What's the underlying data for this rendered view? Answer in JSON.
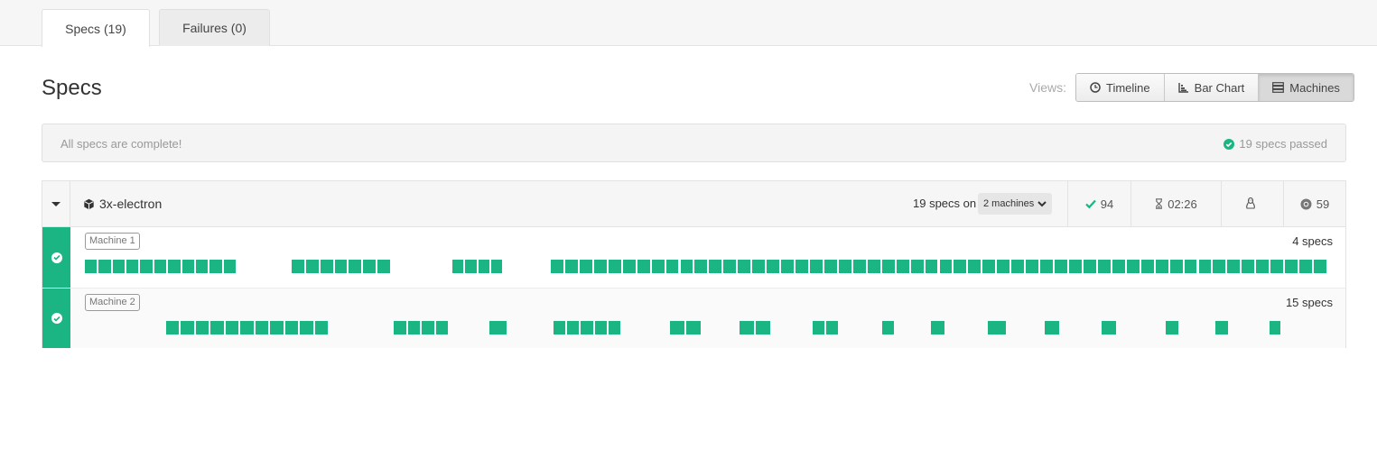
{
  "tabs": [
    {
      "label": "Specs (19)",
      "active": true
    },
    {
      "label": "Failures (0)",
      "active": false
    }
  ],
  "page": {
    "title": "Specs"
  },
  "views": {
    "label": "Views:",
    "buttons": [
      {
        "label": "Timeline",
        "icon": "clock-icon",
        "active": false
      },
      {
        "label": "Bar Chart",
        "icon": "bar-chart-icon",
        "active": false
      },
      {
        "label": "Machines",
        "icon": "server-icon",
        "active": true
      }
    ]
  },
  "status": {
    "message": "All specs are complete!",
    "passed": "19 specs passed"
  },
  "group": {
    "name": "3x-electron",
    "specs_on": "19 specs on",
    "machines_dropdown": "2 machines",
    "passed_count": "94",
    "duration": "02:26",
    "browser_version": "59",
    "icons": {
      "cube": "cube-icon",
      "check": "check-icon",
      "duration": "hourglass-icon",
      "os": "linux-icon",
      "browser": "chrome-icon"
    }
  },
  "machines": [
    {
      "label": "Machine 1",
      "count": "4 specs"
    },
    {
      "label": "Machine 2",
      "count": "15 specs"
    }
  ],
  "colors": {
    "success": "#1ab583",
    "text": "#333333",
    "muted": "#999999"
  }
}
